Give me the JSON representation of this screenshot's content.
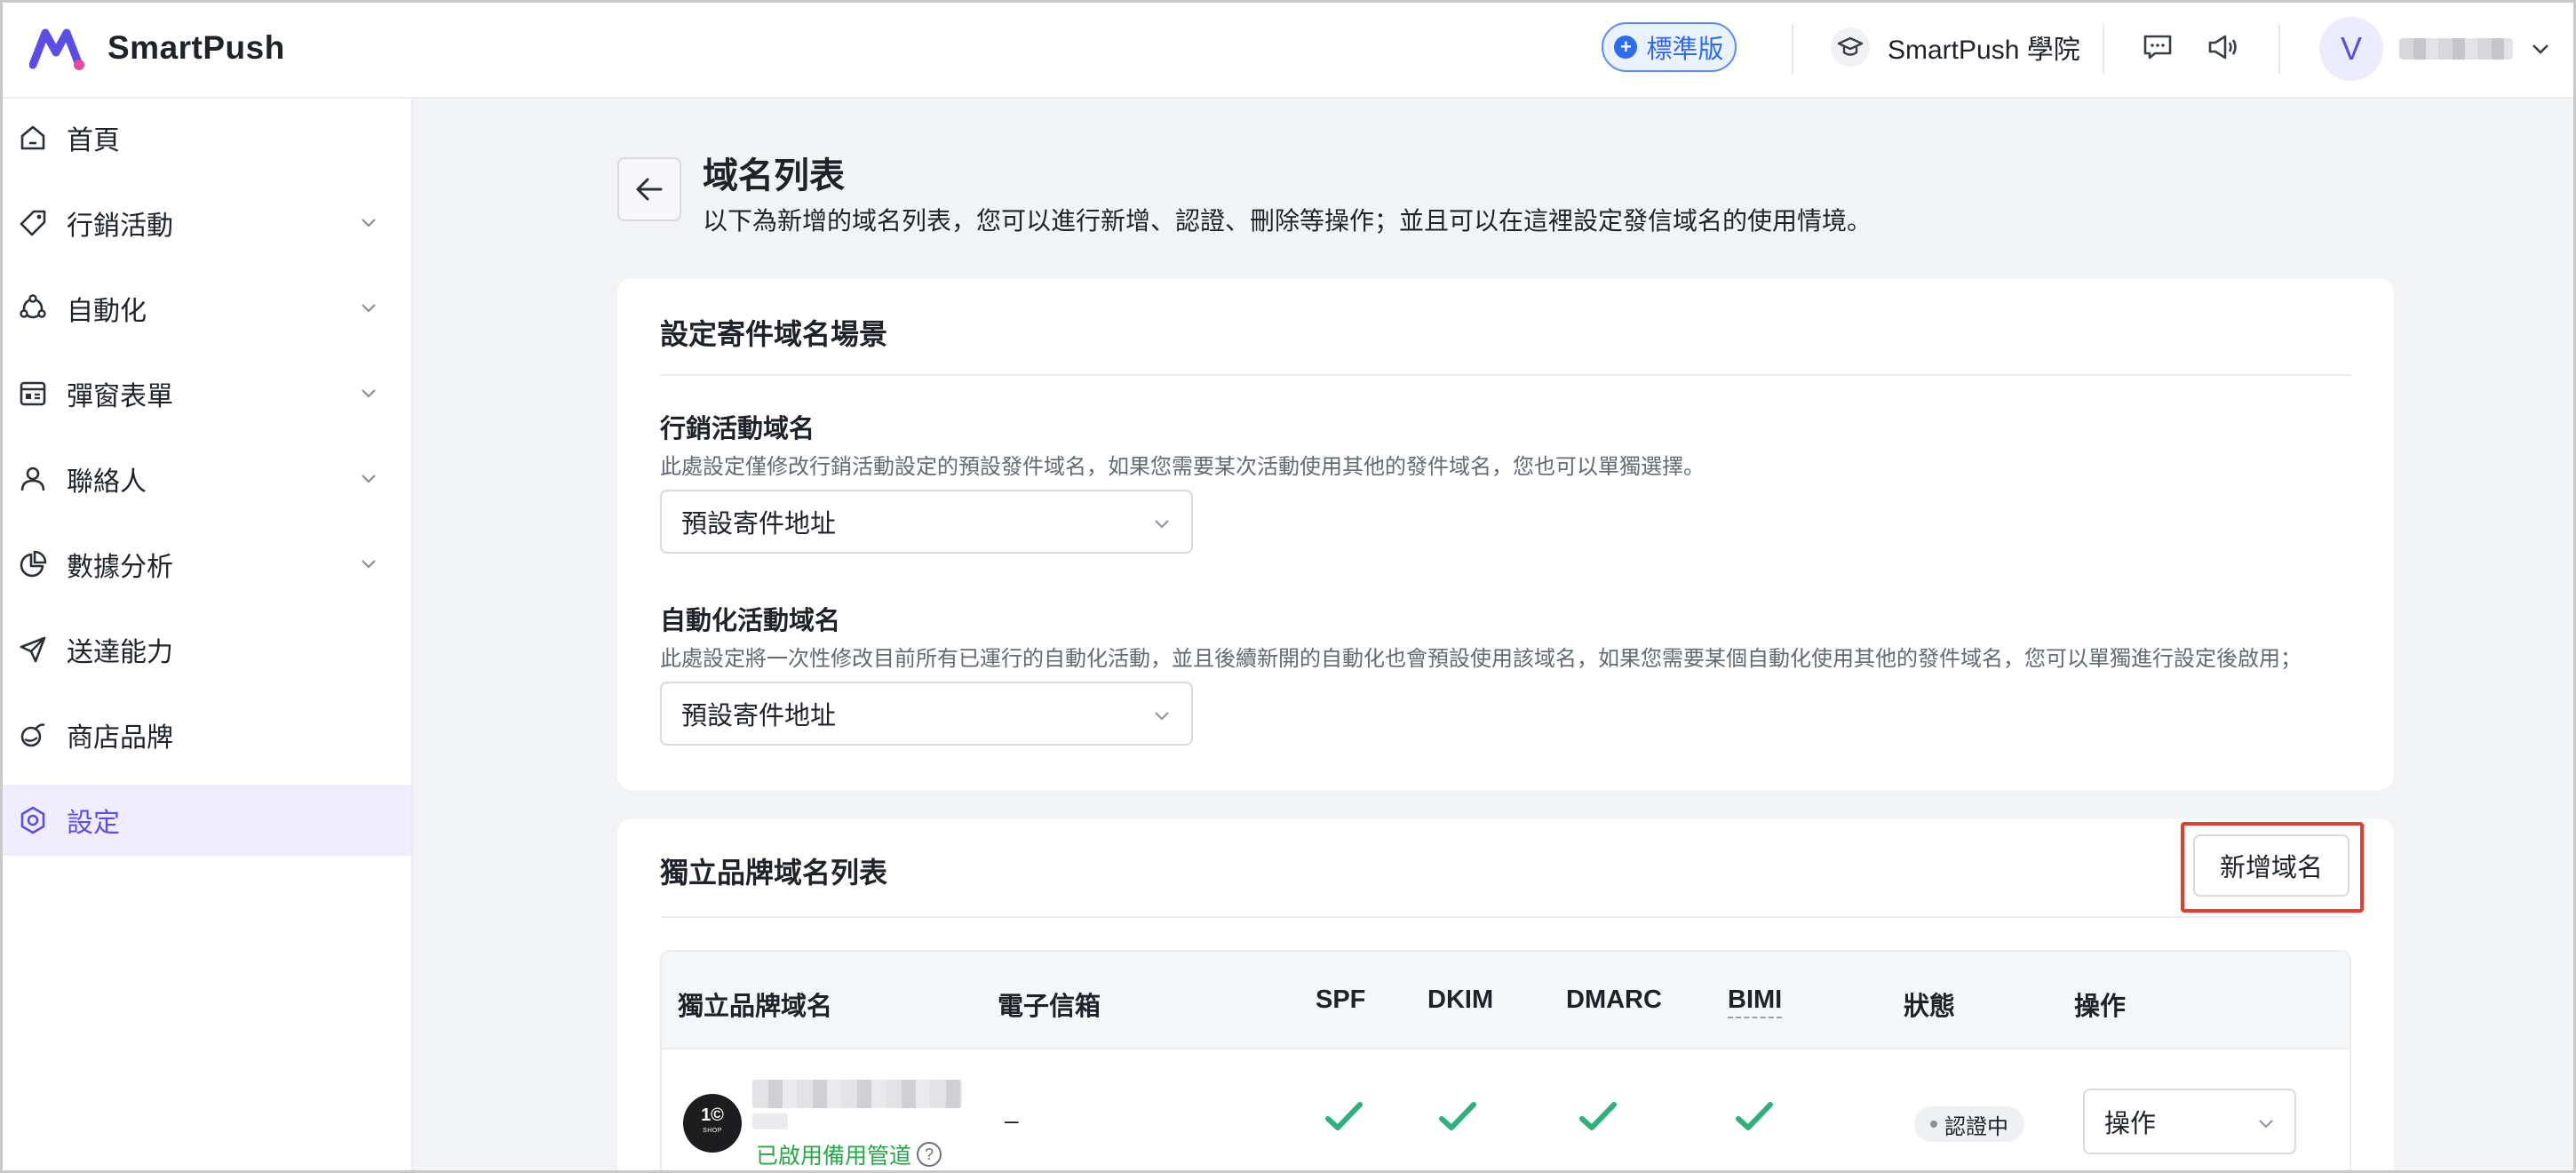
{
  "app": {
    "name": "SmartPush"
  },
  "header": {
    "plan_label": "標準版",
    "academy_label": "SmartPush 學院",
    "avatar_initial": "V"
  },
  "sidebar": {
    "items": [
      {
        "label": "首頁",
        "icon": "home-icon",
        "has_children": false
      },
      {
        "label": "行銷活動",
        "icon": "tag-icon",
        "has_children": true
      },
      {
        "label": "自動化",
        "icon": "automation-icon",
        "has_children": true
      },
      {
        "label": "彈窗表單",
        "icon": "form-icon",
        "has_children": true
      },
      {
        "label": "聯絡人",
        "icon": "user-icon",
        "has_children": true
      },
      {
        "label": "數據分析",
        "icon": "pie-chart-icon",
        "has_children": true
      },
      {
        "label": "送達能力",
        "icon": "send-icon",
        "has_children": false
      },
      {
        "label": "商店品牌",
        "icon": "brand-icon",
        "has_children": false
      },
      {
        "label": "設定",
        "icon": "settings-icon",
        "has_children": false,
        "active": true
      }
    ]
  },
  "page": {
    "title": "域名列表",
    "subtitle": "以下為新增的域名列表，您可以進行新增、認證、刪除等操作；並且可以在這裡設定發信域名的使用情境。"
  },
  "scenario_card": {
    "title": "設定寄件域名場景",
    "marketing": {
      "label": "行銷活動域名",
      "help": "此處設定僅修改行銷活動設定的預設發件域名，如果您需要某次活動使用其他的發件域名，您也可以單獨選擇。",
      "value": "預設寄件地址"
    },
    "automation": {
      "label": "自動化活動域名",
      "help": "此處設定將一次性修改目前所有已運行的自動化活動，並且後續新開的自動化也會預設使用該域名，如果您需要某個自動化使用其他的發件域名，您可以單獨進行設定後啟用；",
      "value": "預設寄件地址"
    }
  },
  "domain_card": {
    "title": "獨立品牌域名列表",
    "add_button": "新增域名",
    "columns": {
      "domain": "獨立品牌域名",
      "email": "電子信箱",
      "spf": "SPF",
      "dkim": "DKIM",
      "dmarc": "DMARC",
      "bimi": "BIMI",
      "status": "狀態",
      "action": "操作"
    },
    "rows": [
      {
        "logo_text": "1©",
        "logo_sub": "SHOP",
        "backup_label": "已啟用備用管道",
        "email": "–",
        "spf": true,
        "dkim": true,
        "dmarc": true,
        "bimi": true,
        "status": "認證中",
        "action": "操作"
      }
    ]
  },
  "colors": {
    "brand": "#5b4ee8",
    "plan_blue": "#2e6bf0",
    "check_green": "#2fb07c",
    "highlight_red": "#e0402e",
    "backup_green": "#28a745"
  }
}
